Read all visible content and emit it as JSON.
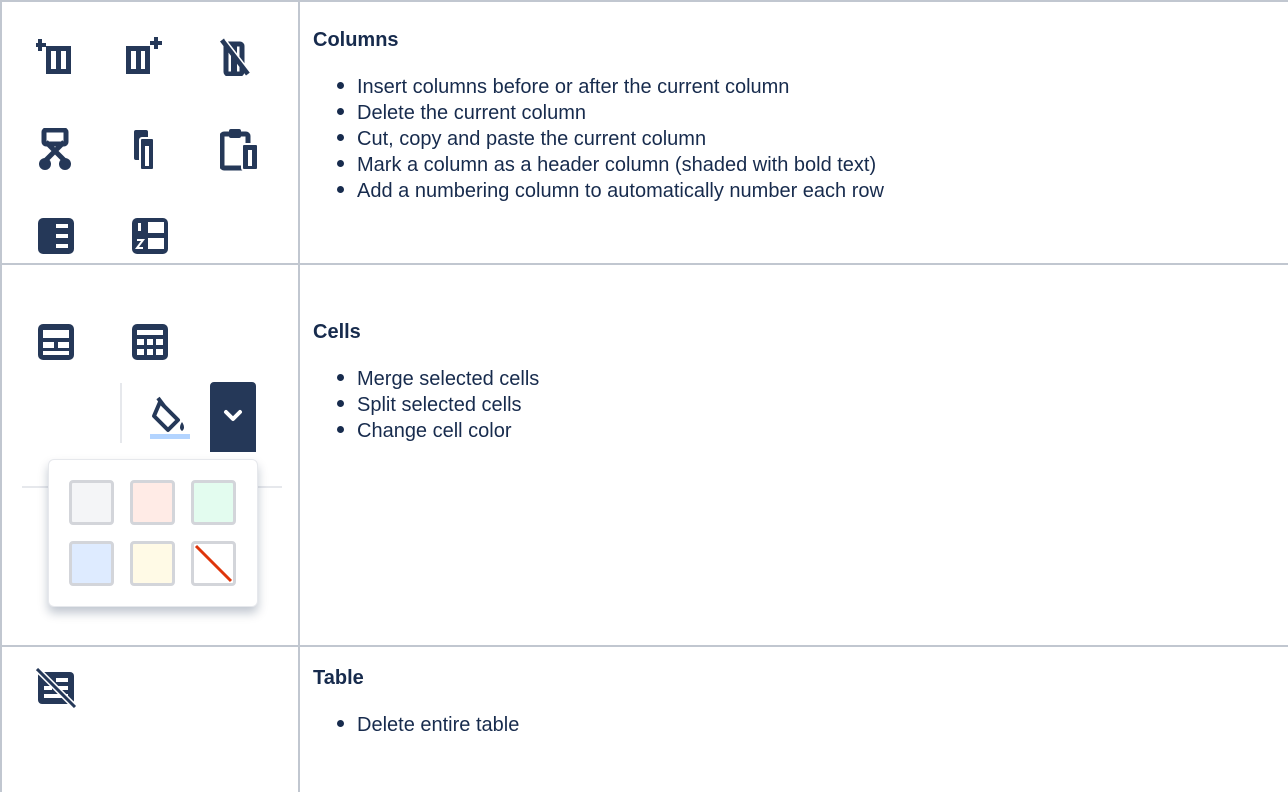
{
  "sections": [
    {
      "heading": "Columns",
      "items": [
        "Insert columns before or after the current column",
        "Delete the current column",
        "Cut, copy and paste the current column",
        "Mark a column as a header column (shaded with bold text)",
        "Add a numbering column to automatically number each row"
      ],
      "icons": [
        "insert-column-before-icon",
        "insert-column-after-icon",
        "delete-column-icon",
        "cut-column-icon",
        "copy-column-icon",
        "paste-column-icon",
        "header-column-icon",
        "numbered-column-icon"
      ]
    },
    {
      "heading": "Cells",
      "items": [
        "Merge selected cells",
        "Split selected cells",
        "Change cell color"
      ],
      "icons": [
        "merge-cells-icon",
        "split-cells-icon",
        "cell-color-icon",
        "chevron-down-icon"
      ],
      "color_swatches": [
        "#f4f5f7",
        "#ffebe6",
        "#e3fcef",
        "#deebff",
        "#fffae6",
        "none"
      ]
    },
    {
      "heading": "Table",
      "items": [
        "Delete entire table"
      ],
      "icons": [
        "delete-table-icon"
      ]
    }
  ],
  "colors": {
    "icon": "#253858",
    "text": "#172b4d",
    "border": "#c1c7d0",
    "accent": "#4c9aff"
  }
}
